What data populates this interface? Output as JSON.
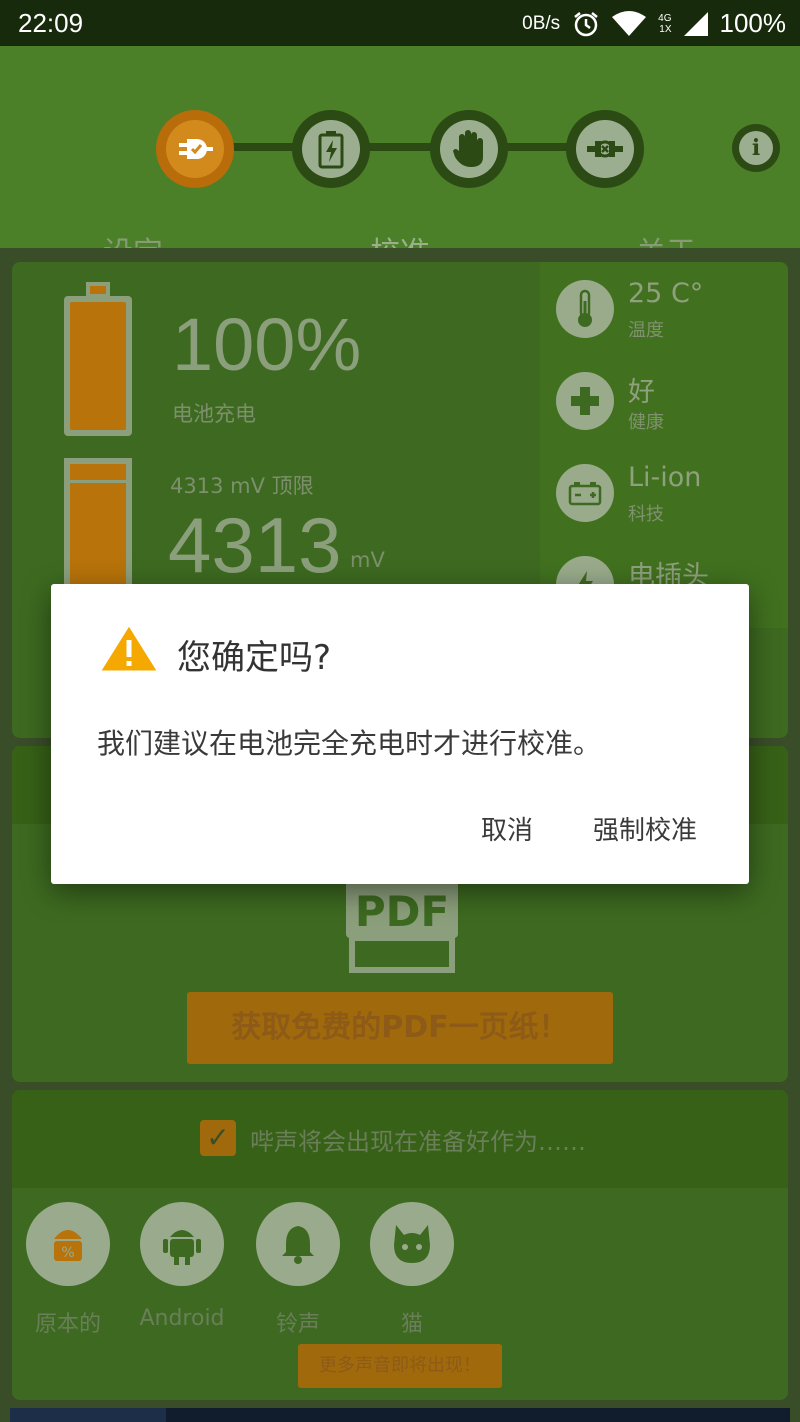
{
  "status_bar": {
    "time": "22:09",
    "speed": "0B/s",
    "net_top": "4G",
    "net_bottom": "1X",
    "battery": "100%"
  },
  "header": {
    "tabs": [
      "设定",
      "校准",
      "关于"
    ],
    "active_tab": "校准",
    "steps": [
      "plug-step-icon",
      "battery-charge-step-icon",
      "hand-step-icon",
      "unplug-step-icon"
    ],
    "active_step": 0,
    "info_glyph": "i"
  },
  "battery_card": {
    "percent": "100%",
    "percent_label": "电池充电",
    "voltage_label": "4313 mV 顶限",
    "voltage": "4313",
    "voltage_unit": "mV",
    "level_fraction": 1.0,
    "details": [
      {
        "value": "25 C°",
        "label": "温度",
        "icon": "thermometer-icon"
      },
      {
        "value": "好",
        "label": "健康",
        "icon": "plus-icon"
      },
      {
        "value": "Li-ion",
        "label": "科技",
        "icon": "battery-tech-icon"
      },
      {
        "value": "电插头",
        "label": "",
        "icon": "power-plug-icon"
      }
    ]
  },
  "pdf_card": {
    "icon_text": "PDF",
    "button_label": "获取免费的PDF一页纸！"
  },
  "sound_card": {
    "checkbox_checked": true,
    "beep_text": "哔声将会出现在准备好作为……",
    "sounds": [
      {
        "label": "原本的",
        "icon": "android-original-icon"
      },
      {
        "label": "Android",
        "icon": "android-icon"
      },
      {
        "label": "铃声",
        "icon": "bell-icon"
      },
      {
        "label": "猫",
        "icon": "cat-icon"
      }
    ],
    "more_label": "更多声音即将出现！"
  },
  "dialog": {
    "title": "您确定吗?",
    "message": "我们建议在电池完全充电时才进行校准。",
    "cancel_label": "取消",
    "confirm_label": "强制校准"
  },
  "colors": {
    "header_green": "#4b7f28",
    "accent_orange": "#d28a1d",
    "warning_yellow": "#f5a800",
    "dialog_bg": "#ffffff"
  }
}
